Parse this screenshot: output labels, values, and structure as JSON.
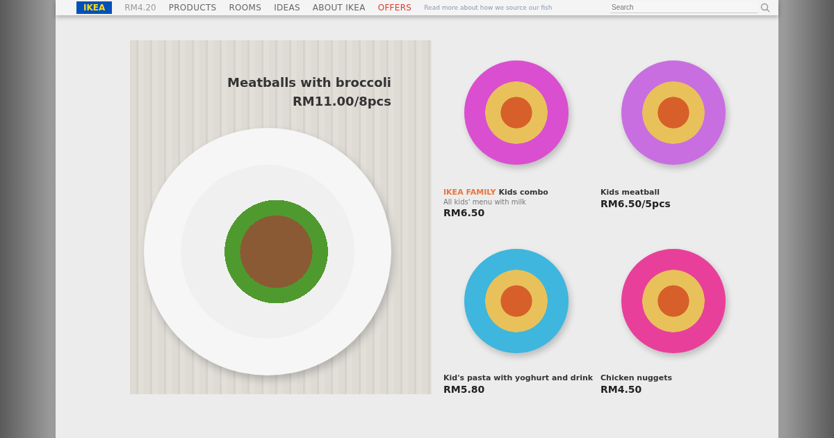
{
  "header": {
    "logo": "IKEA",
    "price_hint": "RM4.20",
    "nav": [
      {
        "label": "PRODUCTS",
        "kind": "normal"
      },
      {
        "label": "ROOMS",
        "kind": "normal"
      },
      {
        "label": "IDEAS",
        "kind": "normal"
      },
      {
        "label": "ABOUT IKEA",
        "kind": "normal"
      },
      {
        "label": "OFFERS",
        "kind": "offer"
      }
    ],
    "notice": "Read more about how we source our fish",
    "search": {
      "placeholder": "Search"
    }
  },
  "feature": {
    "title": "Meatballs with broccoli",
    "price": "RM11.00/8pcs"
  },
  "items": [
    {
      "brand": "IKEA FAMILY",
      "name": "Kids combo",
      "note": "All kids' menu with milk",
      "price": "RM6.50"
    },
    {
      "name": "Kids meatball",
      "price": "RM6.50/5pcs"
    },
    {
      "name": "Kid's pasta with yoghurt and drink",
      "price": "RM5.80"
    },
    {
      "name": "Chicken nuggets",
      "price": "RM4.50"
    }
  ]
}
